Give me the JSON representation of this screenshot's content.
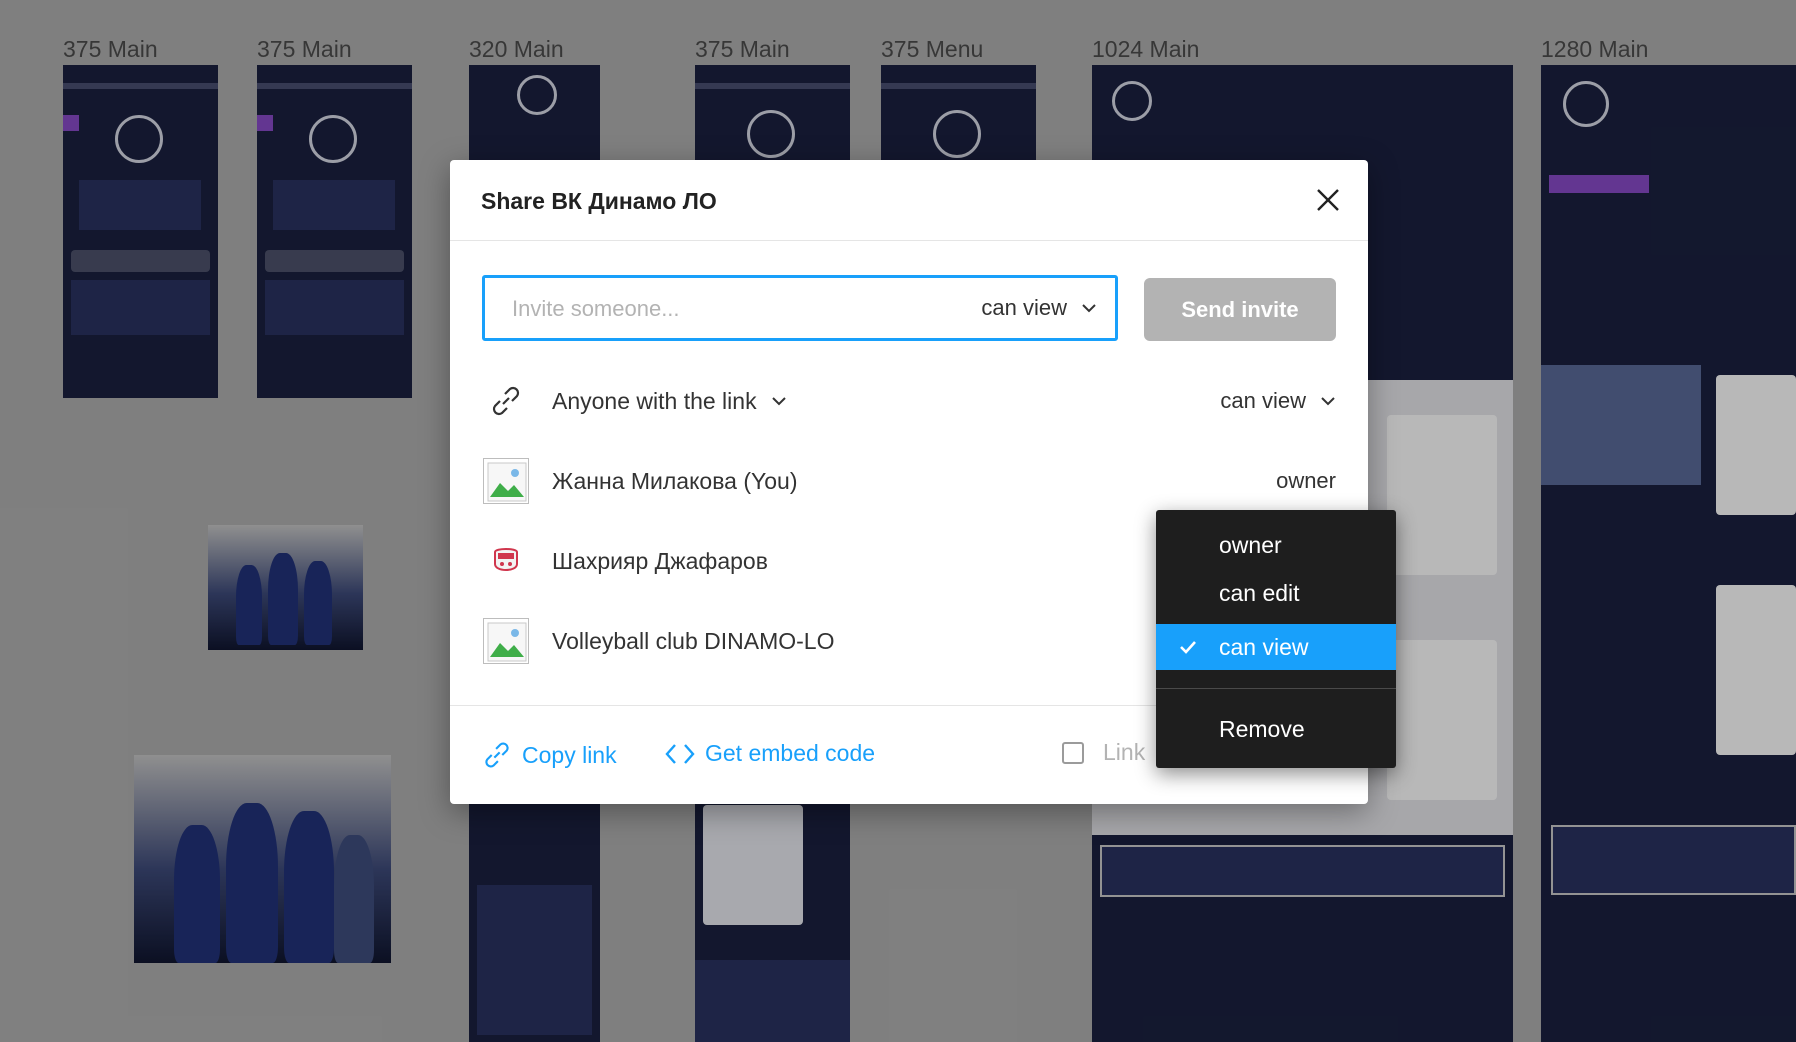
{
  "canvas": {
    "frame_labels": [
      "375 Main",
      "375 Main",
      "320 Main",
      "375 Main",
      "375 Menu",
      "1024 Main",
      "1280 Main"
    ]
  },
  "modal": {
    "title": "Share ВК Динамо ЛО",
    "invite": {
      "placeholder": "Invite someone...",
      "permission": "can view",
      "send_label": "Send invite"
    },
    "link_row": {
      "label": "Anyone with the link",
      "permission": "can view"
    },
    "members": [
      {
        "name": "Жанна Милакова (You)",
        "role": "owner",
        "avatar": "image-placeholder-icon"
      },
      {
        "name": "Шахрияр Джафаров",
        "role": "",
        "avatar": "user-avatar-icon"
      },
      {
        "name": "Volleyball club DINAMO-LO",
        "role": "",
        "avatar": "image-placeholder-icon"
      }
    ],
    "footer": {
      "copy_link": "Copy link",
      "embed_code": "Get embed code",
      "link_checkbox_label": "Link"
    }
  },
  "role_menu": {
    "items": [
      "owner",
      "can edit",
      "can view"
    ],
    "selected": "can view",
    "remove_label": "Remove"
  },
  "colors": {
    "accent": "#18a0fb",
    "menu_bg": "#1e1e1e",
    "disabled_button": "#b3b3b3"
  }
}
